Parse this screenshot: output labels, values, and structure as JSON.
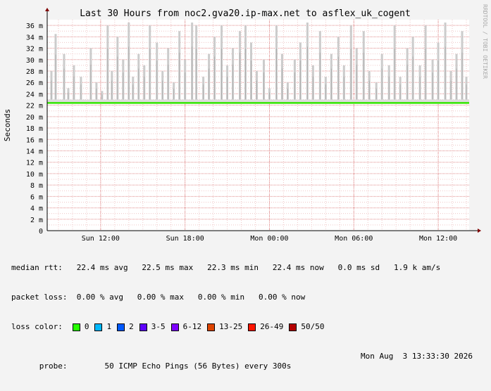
{
  "chart_data": {
    "type": "area",
    "title": "Last 30 Hours from noc2.gva20.ip-max.net to asflex_uk_cogent",
    "ylabel": "Seconds",
    "xlabel": "",
    "watermark": "RRDTOOL / TOBI OETIKER",
    "ylim": [
      0,
      37
    ],
    "yunit": "m",
    "yticks": [
      0,
      2,
      4,
      6,
      8,
      10,
      12,
      14,
      16,
      18,
      20,
      22,
      24,
      26,
      28,
      30,
      32,
      34,
      36
    ],
    "ytick_labels": [
      "0",
      "2 m",
      "4 m",
      "6 m",
      "8 m",
      "10 m",
      "12 m",
      "14 m",
      "16 m",
      "18 m",
      "20 m",
      "22 m",
      "24 m",
      "26 m",
      "28 m",
      "30 m",
      "32 m",
      "34 m",
      "36 m"
    ],
    "xlim": [
      0,
      30
    ],
    "xticks": [
      {
        "x": 3.8,
        "label": "Sun 12:00"
      },
      {
        "x": 9.8,
        "label": "Sun 18:00"
      },
      {
        "x": 15.8,
        "label": "Mon 00:00"
      },
      {
        "x": 21.8,
        "label": "Mon 06:00"
      },
      {
        "x": 27.8,
        "label": "Mon 12:00"
      },
      {
        "x": 33.8,
        "label": ""
      }
    ],
    "grid": true,
    "median_rtt_ms": 22.4,
    "median_color": "#32e600",
    "smoke_color": "#cccccc",
    "spikes": [
      {
        "x": 0.3,
        "max": 28
      },
      {
        "x": 0.6,
        "max": 34.5
      },
      {
        "x": 1.2,
        "max": 31
      },
      {
        "x": 1.5,
        "max": 25
      },
      {
        "x": 1.9,
        "max": 29
      },
      {
        "x": 2.4,
        "max": 27
      },
      {
        "x": 3.1,
        "max": 32
      },
      {
        "x": 3.5,
        "max": 26
      },
      {
        "x": 3.9,
        "max": 24.5
      },
      {
        "x": 4.3,
        "max": 36
      },
      {
        "x": 4.6,
        "max": 28
      },
      {
        "x": 5.0,
        "max": 34
      },
      {
        "x": 5.4,
        "max": 30
      },
      {
        "x": 5.8,
        "max": 36.5
      },
      {
        "x": 6.1,
        "max": 27
      },
      {
        "x": 6.5,
        "max": 31
      },
      {
        "x": 6.9,
        "max": 29
      },
      {
        "x": 7.3,
        "max": 36
      },
      {
        "x": 7.8,
        "max": 33
      },
      {
        "x": 8.2,
        "max": 28
      },
      {
        "x": 8.6,
        "max": 32
      },
      {
        "x": 9.0,
        "max": 26
      },
      {
        "x": 9.4,
        "max": 35
      },
      {
        "x": 9.8,
        "max": 30
      },
      {
        "x": 10.3,
        "max": 36.5
      },
      {
        "x": 10.6,
        "max": 36
      },
      {
        "x": 11.1,
        "max": 27
      },
      {
        "x": 11.5,
        "max": 31
      },
      {
        "x": 11.9,
        "max": 34
      },
      {
        "x": 12.4,
        "max": 36
      },
      {
        "x": 12.8,
        "max": 29
      },
      {
        "x": 13.2,
        "max": 32
      },
      {
        "x": 13.7,
        "max": 35
      },
      {
        "x": 14.1,
        "max": 36
      },
      {
        "x": 14.5,
        "max": 33
      },
      {
        "x": 14.9,
        "max": 28
      },
      {
        "x": 15.4,
        "max": 30
      },
      {
        "x": 15.8,
        "max": 25
      },
      {
        "x": 16.3,
        "max": 36
      },
      {
        "x": 16.7,
        "max": 31
      },
      {
        "x": 17.1,
        "max": 26
      },
      {
        "x": 17.6,
        "max": 30
      },
      {
        "x": 18.0,
        "max": 33
      },
      {
        "x": 18.5,
        "max": 36.5
      },
      {
        "x": 18.9,
        "max": 29
      },
      {
        "x": 19.4,
        "max": 35
      },
      {
        "x": 19.8,
        "max": 27
      },
      {
        "x": 20.2,
        "max": 31
      },
      {
        "x": 20.7,
        "max": 34
      },
      {
        "x": 21.1,
        "max": 29
      },
      {
        "x": 21.6,
        "max": 36
      },
      {
        "x": 22.0,
        "max": 32
      },
      {
        "x": 22.5,
        "max": 35
      },
      {
        "x": 22.9,
        "max": 28
      },
      {
        "x": 23.4,
        "max": 26
      },
      {
        "x": 23.8,
        "max": 31
      },
      {
        "x": 24.3,
        "max": 29
      },
      {
        "x": 24.7,
        "max": 36
      },
      {
        "x": 25.1,
        "max": 27
      },
      {
        "x": 25.6,
        "max": 32
      },
      {
        "x": 26.0,
        "max": 34
      },
      {
        "x": 26.5,
        "max": 29
      },
      {
        "x": 26.9,
        "max": 36
      },
      {
        "x": 27.4,
        "max": 30
      },
      {
        "x": 27.8,
        "max": 33
      },
      {
        "x": 28.3,
        "max": 36.5
      },
      {
        "x": 28.7,
        "max": 28
      },
      {
        "x": 29.1,
        "max": 31
      },
      {
        "x": 29.5,
        "max": 35
      },
      {
        "x": 29.8,
        "max": 27
      }
    ]
  },
  "stats": {
    "median_rtt": "median rtt:   22.4 ms avg   22.5 ms max   22.3 ms min   22.4 ms now   0.0 ms sd   1.9 k am/s",
    "packet_loss": "packet loss:  0.00 % avg   0.00 % max   0.00 % min   0.00 % now",
    "loss_color_label": "loss color:",
    "loss_colors": [
      {
        "label": "0",
        "color": "#26ff00"
      },
      {
        "label": "1",
        "color": "#00b8ff"
      },
      {
        "label": "2",
        "color": "#0059ff"
      },
      {
        "label": "3-5",
        "color": "#5e00ff"
      },
      {
        "label": "6-12",
        "color": "#7e00ff"
      },
      {
        "label": "13-25",
        "color": "#dd4400"
      },
      {
        "label": "26-49",
        "color": "#ff1500"
      },
      {
        "label": "50/50",
        "color": "#b30000"
      }
    ],
    "probe": "probe:        50 ICMP Echo Pings (56 Bytes) every 300s",
    "timestamp": "Mon Aug  3 13:33:30 2026"
  }
}
